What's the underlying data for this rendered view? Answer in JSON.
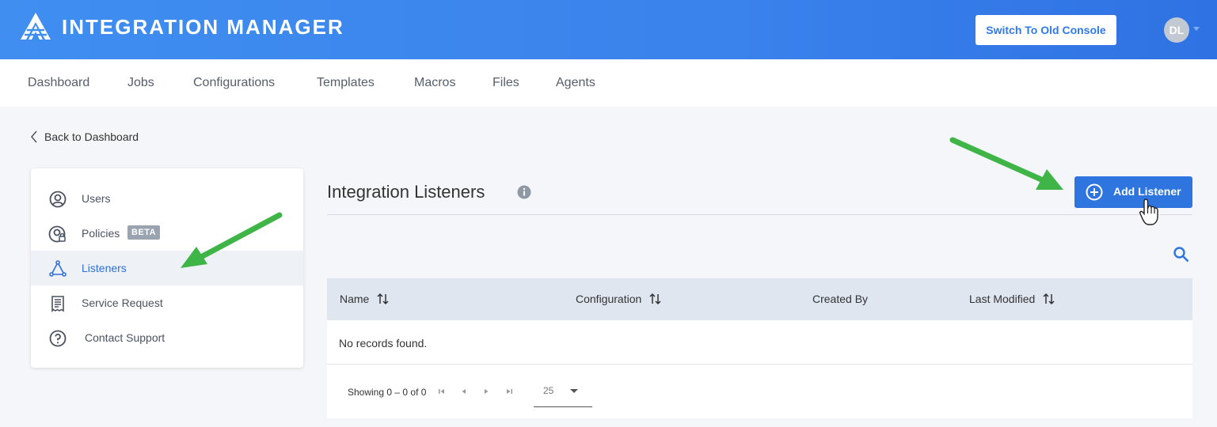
{
  "header": {
    "app_title": "INTEGRATION MANAGER",
    "switch_button": "Switch To Old Console",
    "avatar_initials": "DL"
  },
  "nav": {
    "items": [
      "Dashboard",
      "Jobs",
      "Configurations",
      "Templates",
      "Macros",
      "Files",
      "Agents"
    ]
  },
  "back_link": "Back to Dashboard",
  "sidebar": {
    "items": [
      {
        "label": "Users",
        "icon": "user-circle-icon"
      },
      {
        "label": "Policies",
        "icon": "user-lock-icon",
        "badge": "BETA"
      },
      {
        "label": "Listeners",
        "icon": "network-nodes-icon",
        "active": true
      },
      {
        "label": "Service Request",
        "icon": "receipt-icon"
      },
      {
        "label": "Contact Support",
        "icon": "question-circle-icon"
      }
    ]
  },
  "main": {
    "title": "Integration Listeners",
    "add_button": "Add Listener"
  },
  "table": {
    "columns": [
      {
        "label": "Name",
        "sortable": true
      },
      {
        "label": "Configuration",
        "sortable": true
      },
      {
        "label": "Created By",
        "sortable": false
      },
      {
        "label": "Last Modified",
        "sortable": true
      }
    ],
    "empty_message": "No records found.",
    "showing": "Showing 0 – 0 of 0",
    "page_size": "25"
  },
  "colors": {
    "header_gradient_start": "#3f8ef0",
    "header_gradient_end": "#2f72e3",
    "primary": "#2f75e0",
    "annotation_arrow": "#3fb548"
  }
}
